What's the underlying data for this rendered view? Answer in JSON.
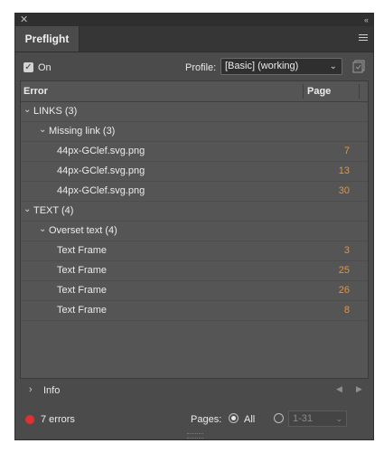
{
  "tab": {
    "label": "Preflight"
  },
  "toolbar": {
    "on_label": "On",
    "profile_label": "Profile:",
    "profile_value": "[Basic] (working)"
  },
  "columns": {
    "error": "Error",
    "page": "Page"
  },
  "rows": [
    {
      "level": 0,
      "expanded": true,
      "text": "LINKS (3)",
      "page": ""
    },
    {
      "level": 1,
      "expanded": true,
      "text": "Missing link (3)",
      "page": ""
    },
    {
      "level": 2,
      "text": "44px-GClef.svg.png",
      "page": "7"
    },
    {
      "level": 2,
      "text": "44px-GClef.svg.png",
      "page": "13"
    },
    {
      "level": 2,
      "text": "44px-GClef.svg.png",
      "page": "30"
    },
    {
      "level": 0,
      "expanded": true,
      "text": "TEXT (4)",
      "page": ""
    },
    {
      "level": 1,
      "expanded": true,
      "text": "Overset text (4)",
      "page": ""
    },
    {
      "level": 2,
      "text": "Text Frame",
      "page": "3"
    },
    {
      "level": 2,
      "text": "Text Frame",
      "page": "25"
    },
    {
      "level": 2,
      "text": "Text Frame",
      "page": "26"
    },
    {
      "level": 2,
      "text": "Text Frame",
      "page": "8"
    }
  ],
  "info": {
    "label": "Info"
  },
  "footer": {
    "errors": "7 errors",
    "pages_label": "Pages:",
    "all_label": "All",
    "range_value": "1-31"
  },
  "colors": {
    "error_dot": "#e0312f",
    "page_number": "#f0912e"
  }
}
